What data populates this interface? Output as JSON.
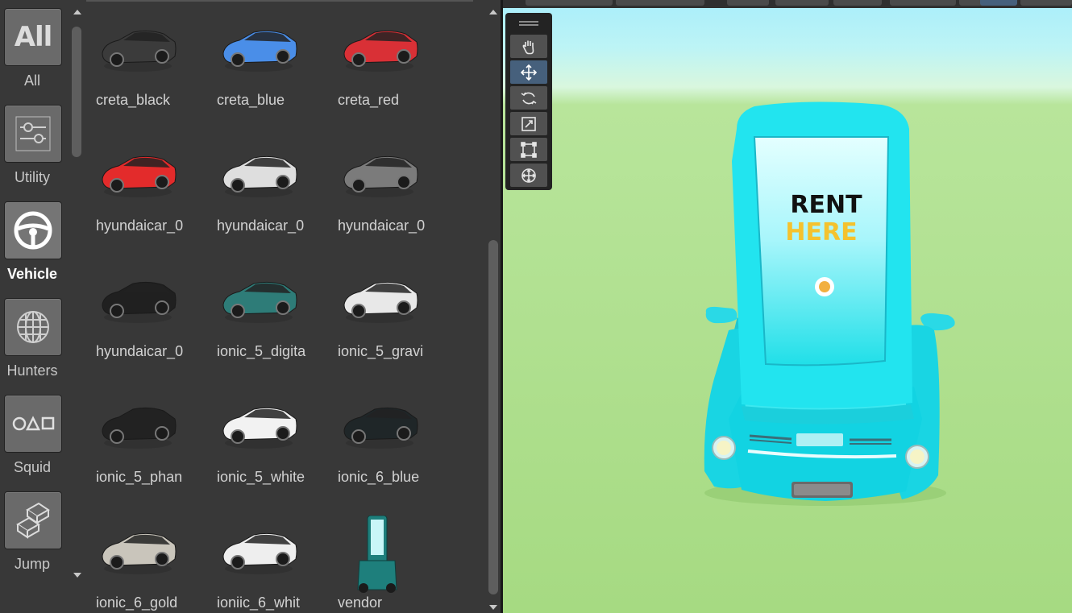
{
  "categories": [
    {
      "label": "All",
      "icon": "all-text-icon",
      "icon_text": "All",
      "active": false
    },
    {
      "label": "Utility",
      "icon": "sliders-icon",
      "active": false
    },
    {
      "label": "Vehicle",
      "icon": "steering-wheel-icon",
      "active": true
    },
    {
      "label": "Hunters",
      "icon": "globe-grid-icon",
      "active": false
    },
    {
      "label": "Squid",
      "icon": "circle-triangle-square-icon",
      "active": false
    },
    {
      "label": "Jump",
      "icon": "stacked-blocks-icon",
      "active": false
    }
  ],
  "assets": [
    {
      "name": "creta_black",
      "color": "#3b3b3b"
    },
    {
      "name": "creta_blue",
      "color": "#4a8ee8"
    },
    {
      "name": "creta_red",
      "color": "#d93036"
    },
    {
      "name": "hyundaicar_0",
      "color": "#e32b2b"
    },
    {
      "name": "hyundaicar_0",
      "color": "#dedede"
    },
    {
      "name": "hyundaicar_0",
      "color": "#7b7b7b"
    },
    {
      "name": "hyundaicar_0",
      "color": "#202020"
    },
    {
      "name": "ionic_5_digita",
      "color": "#2e7c78"
    },
    {
      "name": "ionic_5_gravi",
      "color": "#e8e8e8"
    },
    {
      "name": "ionic_5_phan",
      "color": "#222222"
    },
    {
      "name": "ionic_5_white",
      "color": "#f2f2f2"
    },
    {
      "name": "ionic_6_blue",
      "color": "#1f2628"
    },
    {
      "name": "ionic_6_gold",
      "color": "#c9c5bb"
    },
    {
      "name": "ioniic_6_whit",
      "color": "#eeeeee"
    },
    {
      "name": "vendor",
      "color": "#1e7f7c"
    }
  ],
  "scene": {
    "sign_line1": "RENT",
    "sign_line2": "HERE",
    "tools": [
      "hand-tool-icon",
      "move-tool-icon",
      "rotate-tool-icon",
      "scale-tool-icon",
      "rect-tool-icon",
      "transform-tool-icon"
    ],
    "active_tool": "move-tool-icon",
    "colors": {
      "kiosk": "#22e8f0",
      "sign_text": "#111111",
      "sign_accent": "#f4c22e",
      "ground": "#a6da82",
      "sky": "#a9eefb"
    }
  }
}
